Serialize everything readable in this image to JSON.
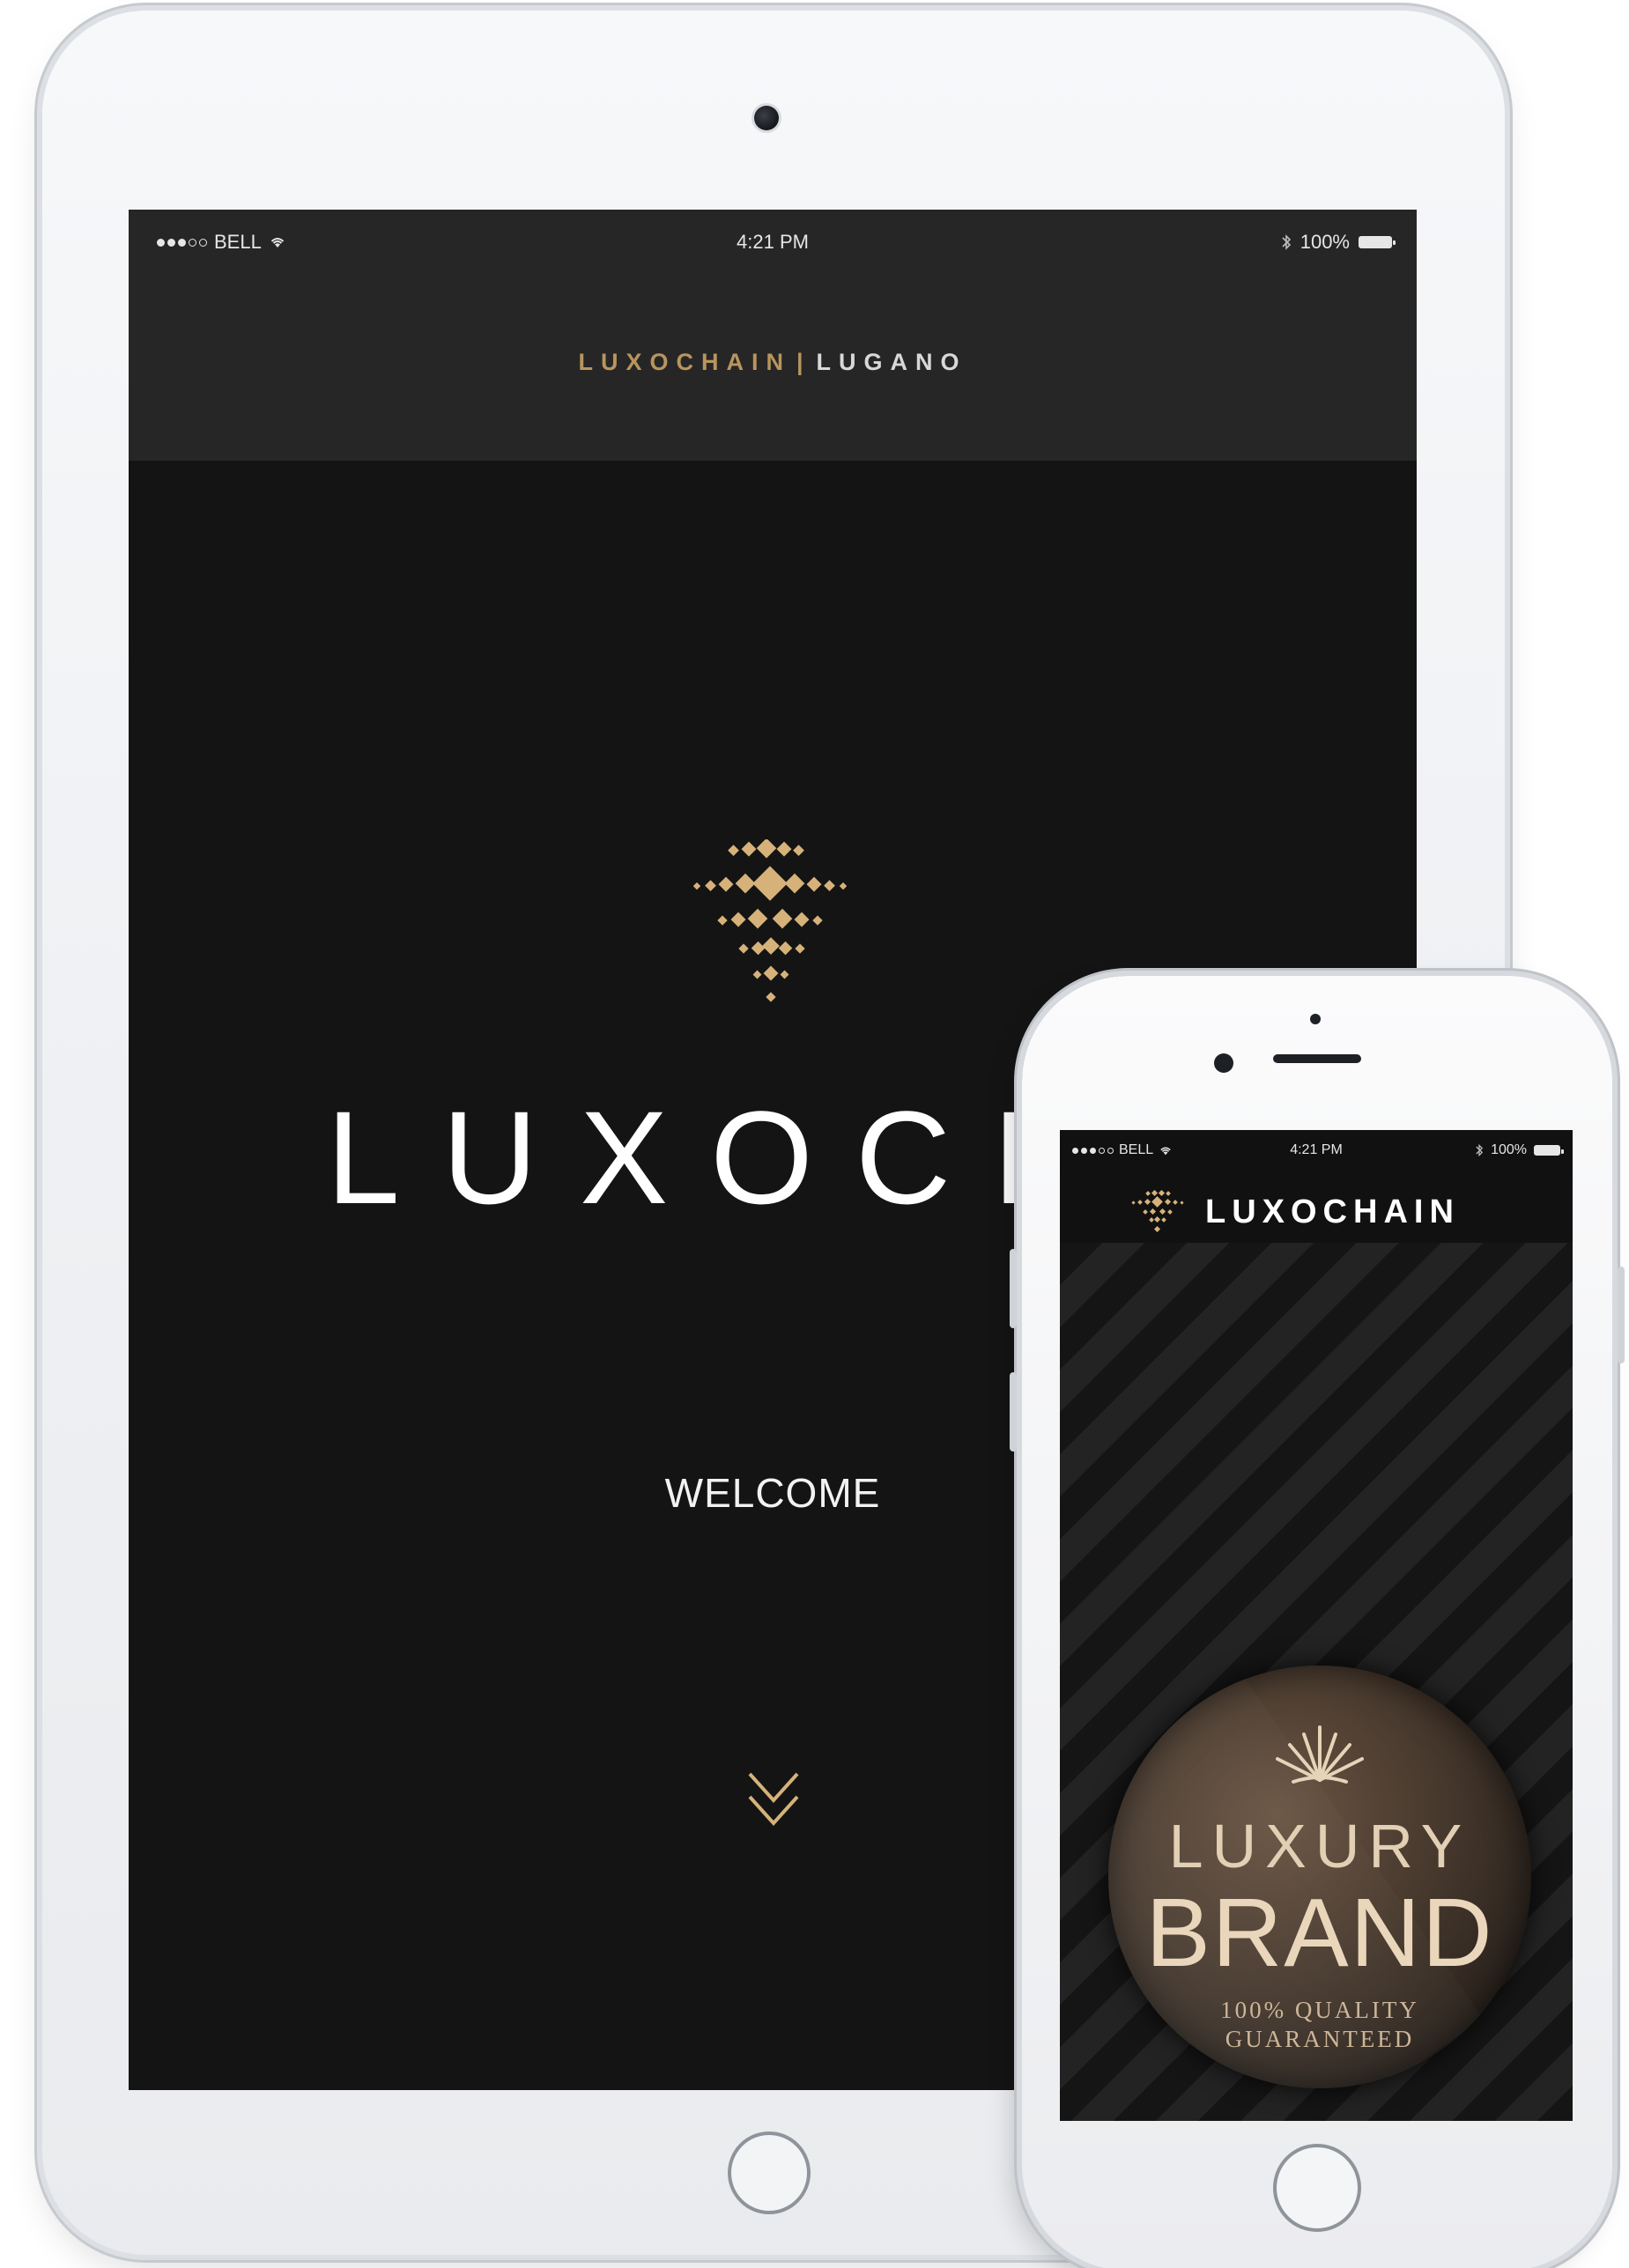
{
  "tablet": {
    "status_bar": {
      "carrier": "BELL",
      "time": "4:21 PM",
      "battery": "100%"
    },
    "header": {
      "brand": "LUXOCHAIN",
      "separator": "|",
      "city": "LUGANO"
    },
    "wordmark": "LUXOCHA",
    "welcome": "WELCOME",
    "icons": [
      "wifi-icon",
      "bluetooth-icon",
      "battery-icon",
      "diamond-logo-icon",
      "double-chevron-down-icon"
    ]
  },
  "phone": {
    "status_bar": {
      "carrier": "BELL",
      "time": "4:21 PM",
      "battery": "100%"
    },
    "header": {
      "brand": "LUXOCHAIN"
    },
    "badge": {
      "line1": "LUXURY",
      "line2": "BRAND",
      "line3": "100% QUALITY",
      "line4": "GUARANTEED"
    },
    "icons": [
      "wifi-icon",
      "bluetooth-icon",
      "battery-icon",
      "diamond-logo-icon",
      "crown-icon"
    ]
  },
  "colors": {
    "gold": "#b8955e",
    "screen_bg": "#141414",
    "header_bg": "#262626"
  }
}
